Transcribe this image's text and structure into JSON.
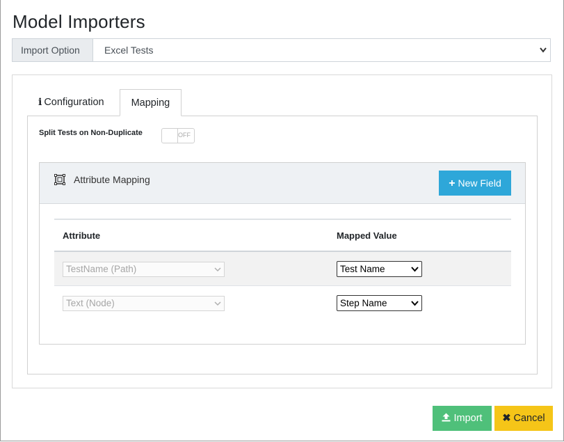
{
  "dialog": {
    "title": "Model Importers"
  },
  "import_option": {
    "label": "Import Option",
    "selected": "Excel Tests"
  },
  "tabs": [
    {
      "label": "Configuration",
      "icon": "info-icon",
      "active": false
    },
    {
      "label": "Mapping",
      "active": true
    }
  ],
  "split_tests": {
    "label": "Split Tests on Non-Duplicate",
    "toggle_state": "OFF"
  },
  "attribute_mapping": {
    "title": "Attribute Mapping",
    "icon": "mapping-icon",
    "new_field_label": "New Field",
    "columns": [
      "Attribute",
      "Mapped Value"
    ],
    "rows": [
      {
        "attribute": "TestName (Path)",
        "mapped_value": "Test Name"
      },
      {
        "attribute": "Text (Node)",
        "mapped_value": "Step Name"
      }
    ]
  },
  "footer": {
    "import_label": "Import",
    "cancel_label": "Cancel"
  },
  "colors": {
    "new_field_bg": "#2ea7d9",
    "import_bg": "#4fc07a",
    "cancel_bg": "#f5c518"
  }
}
